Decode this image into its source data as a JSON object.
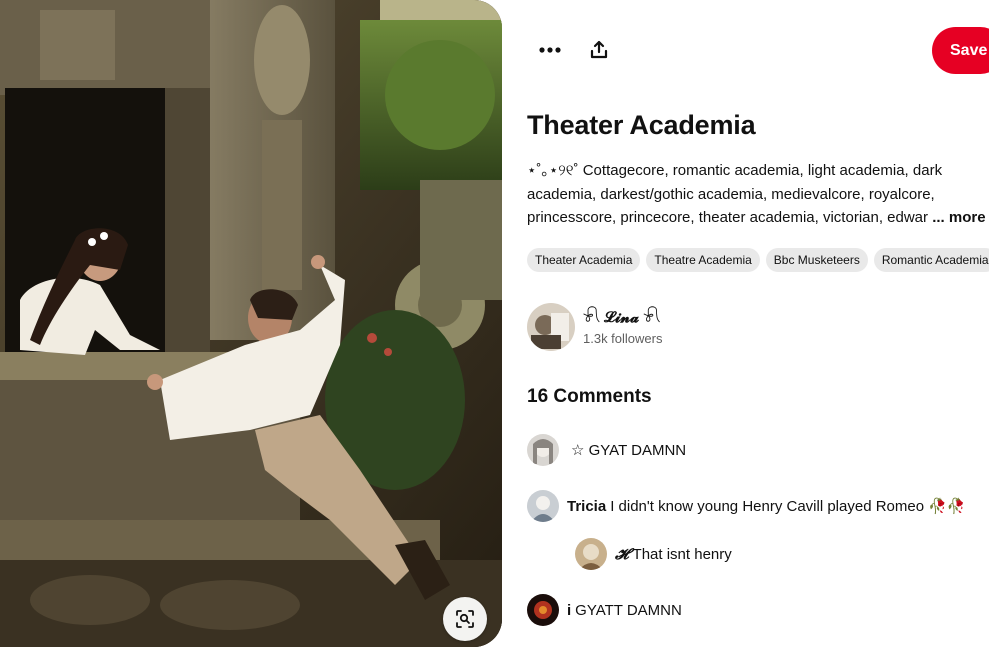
{
  "toolbar": {
    "more_icon": "ellipsis-icon",
    "share_icon": "share-icon",
    "save_label": "Save"
  },
  "pin": {
    "title": "Theater Academia",
    "description": "⋆˚｡⋆୨୧˚ Cottagecore, romantic academia, light academia, dark academia, darkest/gothic academia, medievalcore, royalcore, princesscore, princecore, theater academia, victorian, edwar",
    "more_label": "... more",
    "tags": [
      "Theater Academia",
      "Theatre Academia",
      "Bbc Musketeers",
      "Romantic Academia"
    ]
  },
  "creator": {
    "name": "𓍯 𝓛𝓲𝓷𝓪 𓍯",
    "followers": "1.3k followers"
  },
  "comments": {
    "heading": "16 Comments",
    "items": [
      {
        "user": "",
        "text": "☆ GYAT DAMNN"
      },
      {
        "user": "Tricia",
        "text": "I didn't know young Henry Cavill played Romeo 🥀🥀"
      },
      {
        "user": "𝓗",
        "text": "That isnt henry"
      },
      {
        "user": "i",
        "text": "GYATT DAMNN"
      }
    ]
  },
  "colors": {
    "save_red": "#e60023",
    "tag_bg": "#e9e9e9",
    "muted_text": "#5f5f5f"
  },
  "image": {
    "lens_icon": "visual-search-icon"
  }
}
